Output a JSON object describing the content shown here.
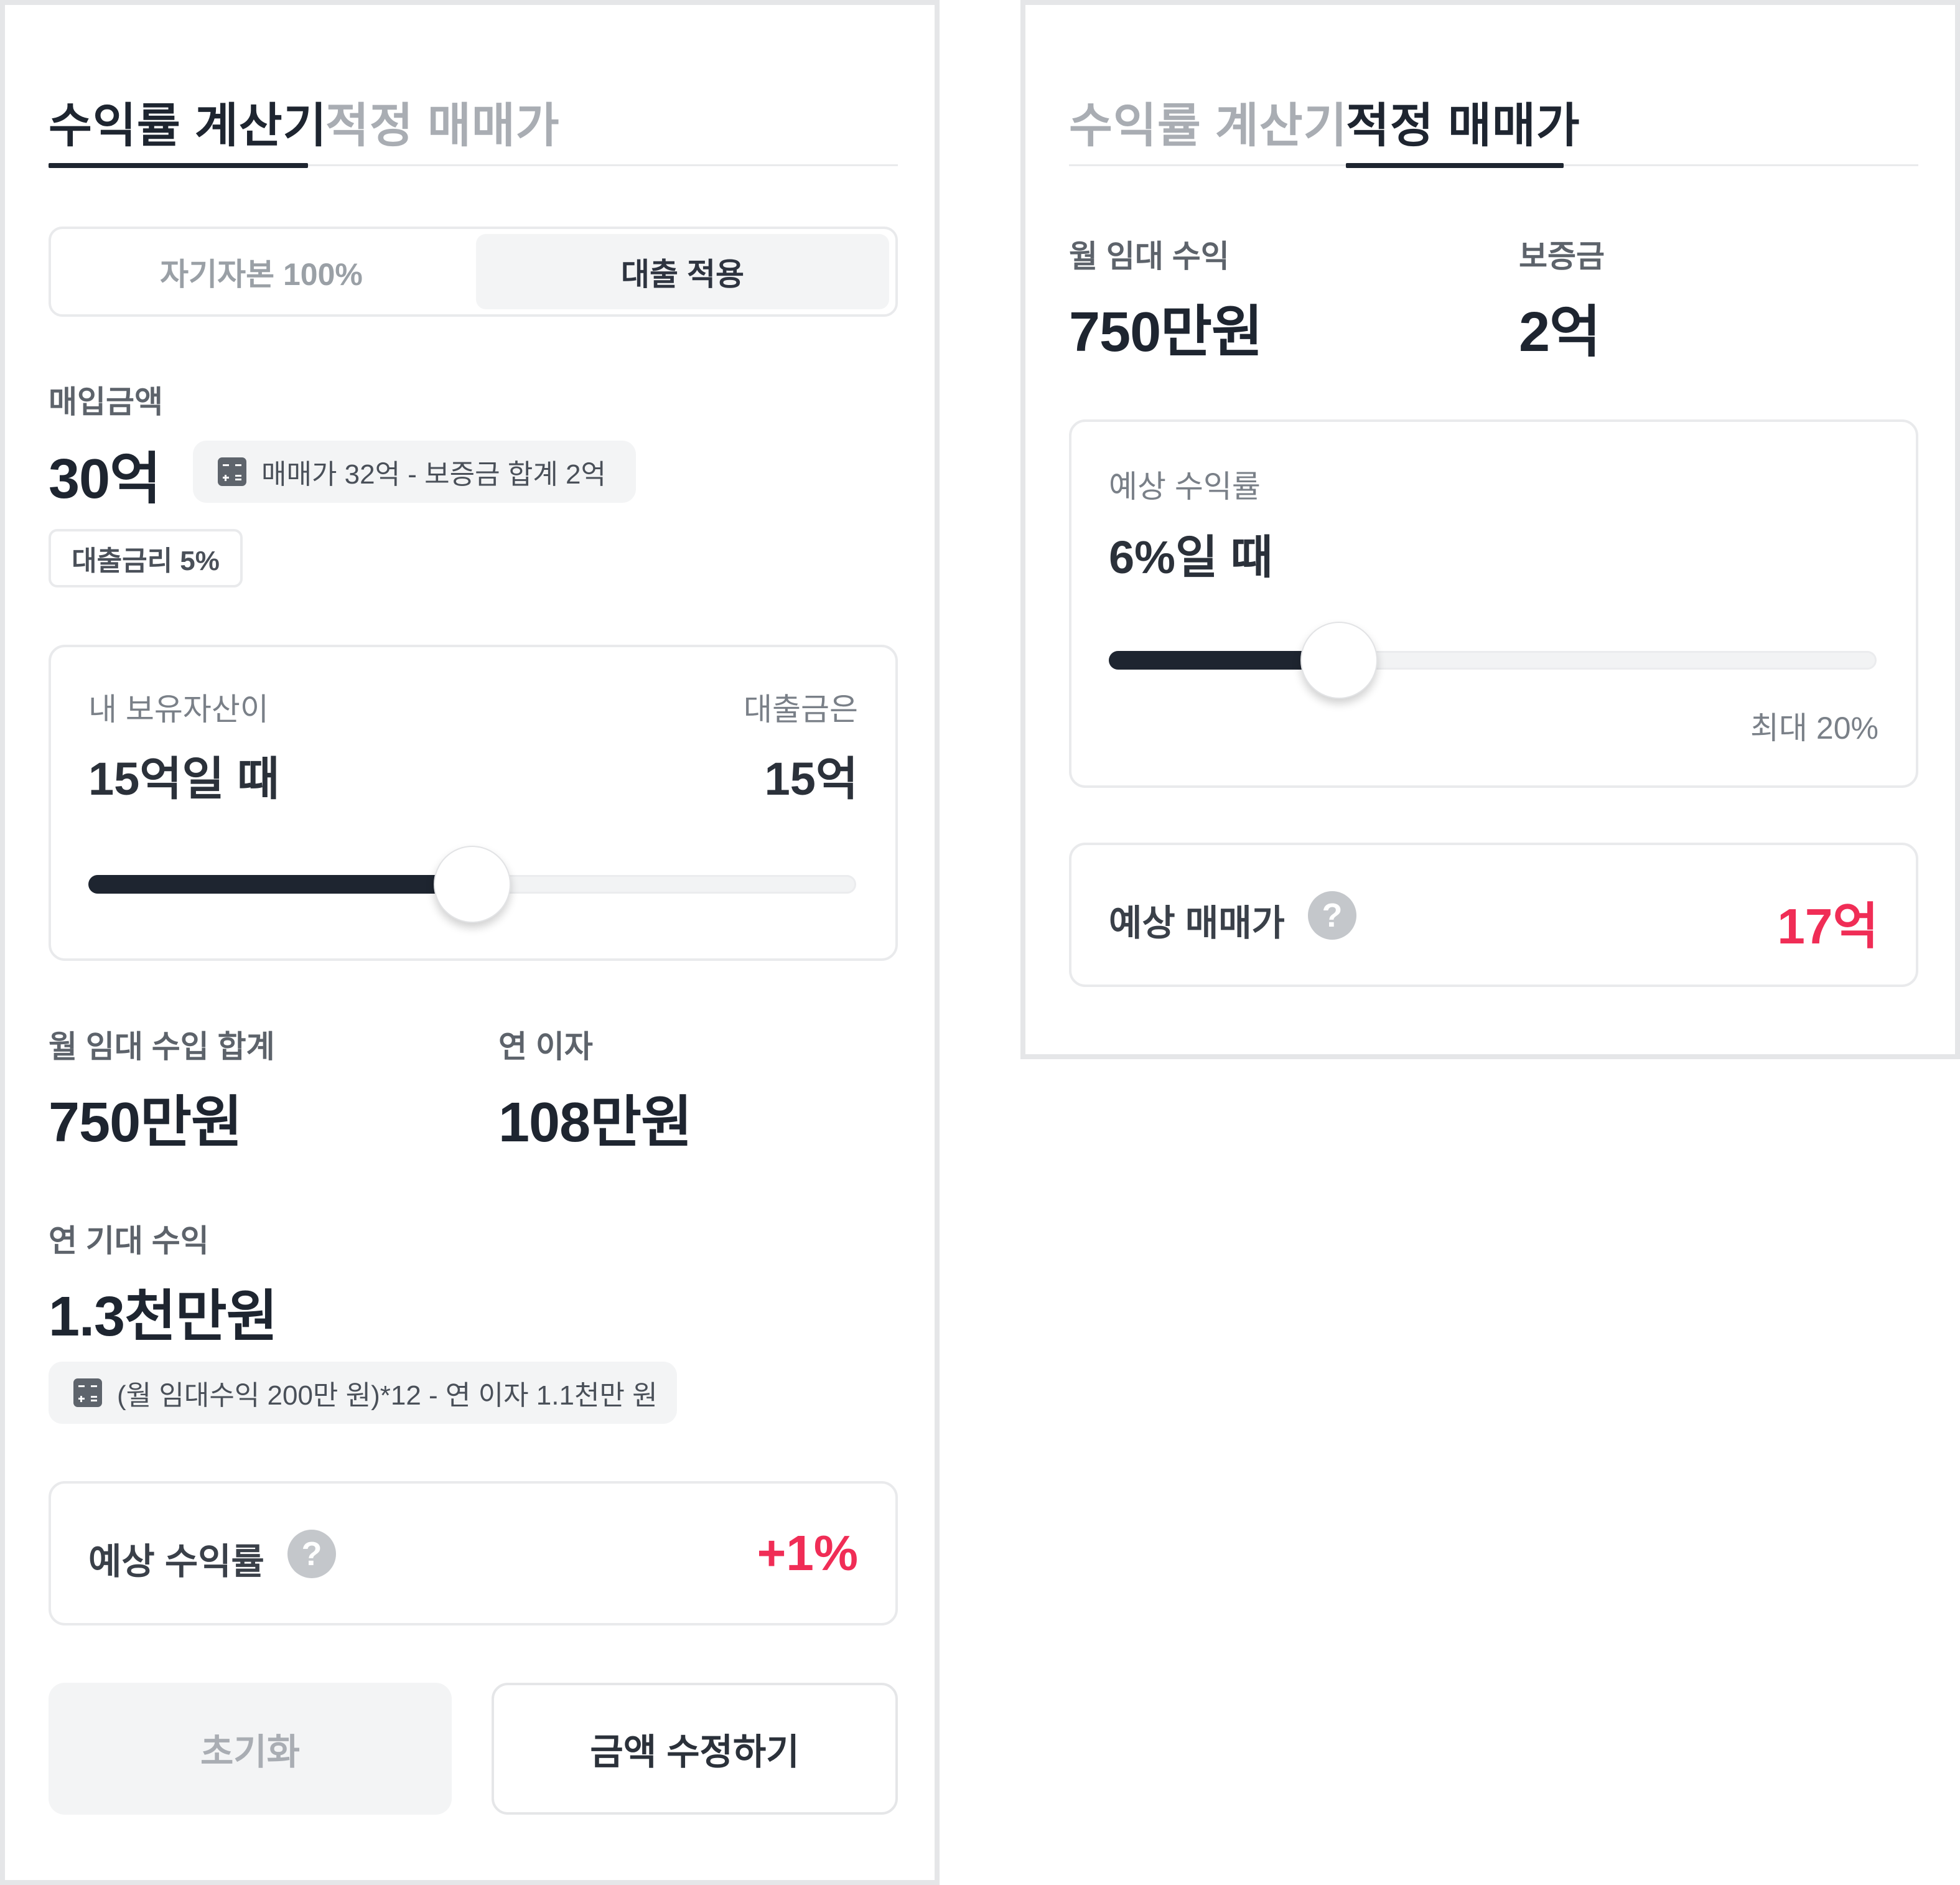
{
  "calculator": {
    "tabs": {
      "yield": "수익률 계산기",
      "price": "적정 매매가"
    },
    "segmented": {
      "equity": "자기자본 100%",
      "loan": "대출 적용"
    },
    "purchase": {
      "label": "매입금액",
      "value": "30억",
      "formula": "매매가 32억 - 보증금 합계 2억"
    },
    "loan_rate_chip": "대출금리 5%",
    "asset_card": {
      "my_assets_label": "내 보유자산이",
      "my_assets_value": "15억일 때",
      "loan_label": "대출금은",
      "loan_value": "15억",
      "slider_fraction": 0.5
    },
    "monthly_rent": {
      "label": "월 임대 수입 합계",
      "value": "750만원"
    },
    "annual_interest": {
      "label": "연 이자",
      "value": "108만원"
    },
    "annual_income": {
      "label": "연 기대 수익",
      "value": "1.3천만원",
      "formula": "(월 임대수익 200만 원)*12 - 연 이자 1.1천만 원"
    },
    "expected_yield": {
      "label": "예상 수익률",
      "help": "?",
      "value": "+1%"
    },
    "buttons": {
      "reset": "초기화",
      "edit": "금액 수정하기"
    }
  },
  "pricer": {
    "tabs": {
      "yield": "수익률 계산기",
      "price": "적정 매매가"
    },
    "monthly_rent": {
      "label": "월 임대 수익",
      "value": "750만원"
    },
    "deposit": {
      "label": "보증금",
      "value": "2억"
    },
    "yield_card": {
      "label": "예상 수익률",
      "value": "6%일 때",
      "max_label": "최대 20%",
      "slider_fraction": 0.3
    },
    "expected_price": {
      "label": "예상 매매가",
      "help": "?",
      "value": "17억"
    }
  },
  "colors": {
    "text": "#1e2530",
    "muted": "#a9adb3",
    "accent_red": "#f02d56",
    "border": "#e9eaec"
  },
  "icons": [
    "calculator-icon",
    "question-icon",
    "slider-thumb"
  ]
}
